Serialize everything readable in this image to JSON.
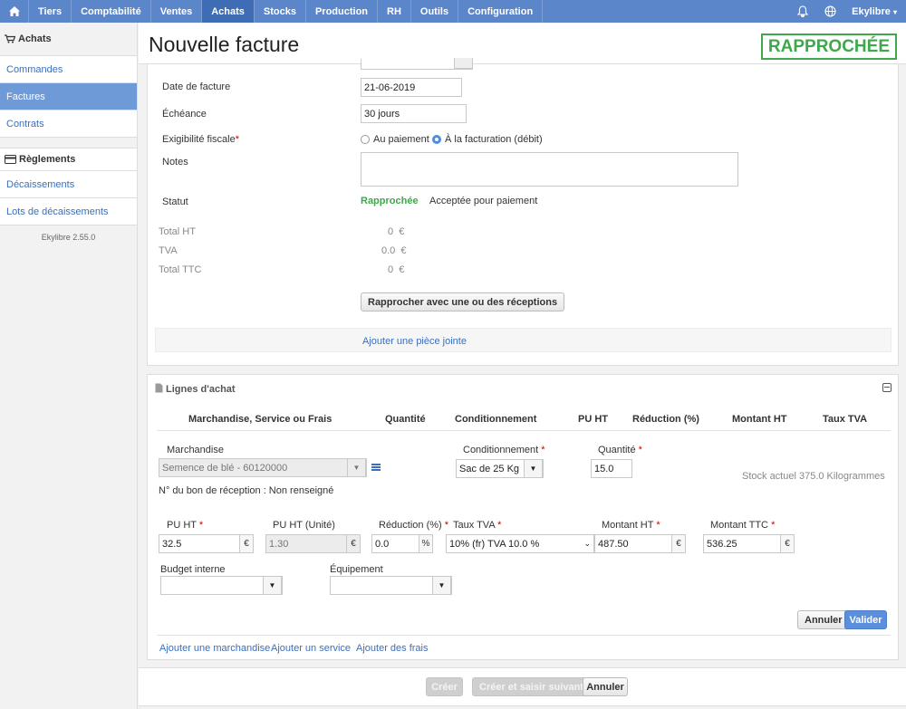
{
  "nav": {
    "items": [
      "Tiers",
      "Comptabilité",
      "Ventes",
      "Achats",
      "Stocks",
      "Production",
      "RH",
      "Outils",
      "Configuration"
    ],
    "active": "Achats",
    "user": "Ekylibre"
  },
  "sidebar": {
    "section1": "Achats",
    "items1": [
      "Commandes",
      "Factures",
      "Contrats"
    ],
    "section2": "Règlements",
    "items2": [
      "Décaissements",
      "Lots de décaissements"
    ],
    "version": "Ekylibre 2.55.0"
  },
  "header": {
    "title": "Nouvelle facture",
    "status_stamp": "RAPPROCHÉE"
  },
  "form": {
    "invoice_date_label": "Date de facture",
    "invoice_date": "21-06-2019",
    "due_label": "Échéance",
    "due_value": "30 jours",
    "tax_label": "Exigibilité fiscale",
    "tax_option_1": "Au paiement",
    "tax_option_2": "À la facturation (débit)",
    "tax_selected": "À la facturation (débit)",
    "notes_label": "Notes",
    "status_label": "Statut",
    "status_value": "Rapprochée",
    "status_other": "Acceptée pour paiement",
    "total_ht_label": "Total HT",
    "total_ht": "0",
    "tva_label": "TVA",
    "tva": "0.0",
    "total_ttc_label": "Total TTC",
    "total_ttc": "0",
    "currency": "€",
    "reconcile_button": "Rapprocher avec une ou des réceptions",
    "attach_link": "Ajouter une pièce jointe"
  },
  "lines": {
    "title": "Lignes d'achat",
    "headers": [
      "Marchandise, Service ou Frais",
      "Quantité",
      "Conditionnement",
      "PU HT",
      "Réduction (%)",
      "Montant HT",
      "Taux TVA"
    ],
    "product_label": "Marchandise",
    "product_value": "Semence de blé - 60120000",
    "packaging_label": "Conditionnement",
    "packaging_value": "Sac de 25 Kg",
    "quantity_label": "Quantité",
    "quantity_value": "15.0",
    "stock_info": "Stock actuel 375.0 Kilogrammes",
    "reception_info": "N° du bon de réception : Non renseigné",
    "pu_ht_label": "PU HT",
    "pu_ht_value": "32.5",
    "pu_unit_label": "PU HT (Unité)",
    "pu_unit_value": "1.30",
    "reduction_label": "Réduction (%)",
    "reduction_value": "0.0",
    "vat_label": "Taux TVA",
    "vat_value": "10% (fr) TVA 10.0 %",
    "amount_ht_label": "Montant HT",
    "amount_ht_value": "487.50",
    "amount_ttc_label": "Montant TTC",
    "amount_ttc_value": "536.25",
    "budget_label": "Budget interne",
    "equipment_label": "Équipement",
    "cancel_button": "Annuler",
    "validate_button": "Valider",
    "add_product_link": "Ajouter une marchandise",
    "add_service_link": "Ajouter un service",
    "add_fees_link": "Ajouter des frais",
    "currency": "€",
    "percent": "%"
  },
  "footer": {
    "create": "Créer",
    "create_next": "Créer et saisir suivant",
    "cancel": "Annuler"
  },
  "colors": {
    "nav_bg": "#5b86c9",
    "accent": "#3b6fbd",
    "status_green": "#3ea84a"
  }
}
